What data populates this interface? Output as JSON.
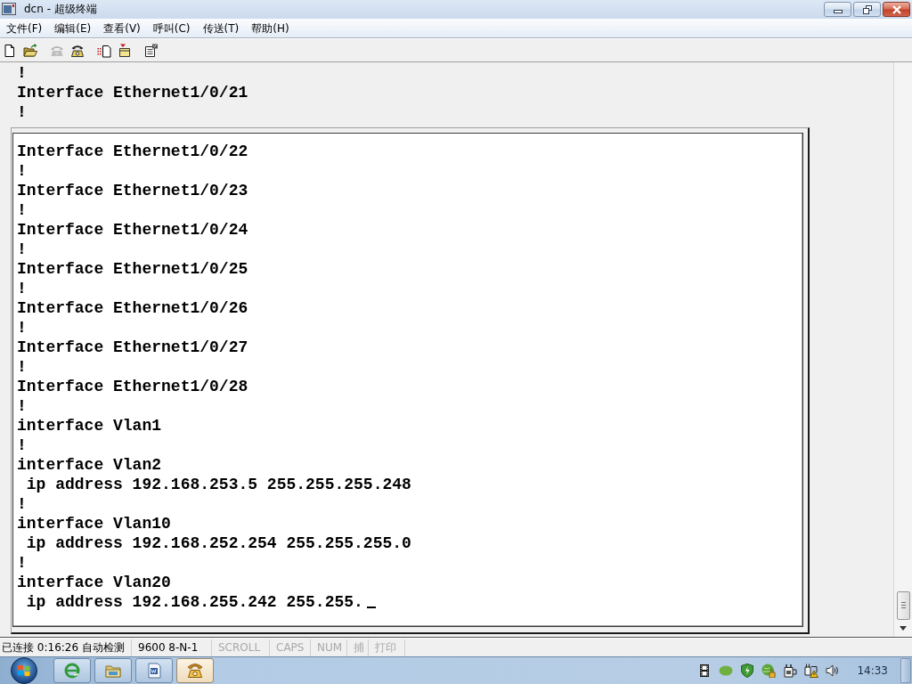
{
  "window": {
    "title": "dcn - 超级终端"
  },
  "menu_bar": [
    "文件(F)",
    "编辑(E)",
    "查看(V)",
    "呼叫(C)",
    "传送(T)",
    "帮助(H)"
  ],
  "toolbar": [
    {
      "disabled": false
    },
    {
      "disabled": false
    },
    {
      "disabled": true
    },
    {
      "disabled": false
    },
    {
      "disabled": false
    },
    {
      "disabled": false
    },
    {
      "disabled": false
    }
  ],
  "terminal": {
    "lines": [
      "!",
      "Interface Ethernet1/0/21",
      "!"
    ],
    "panel": {
      "lines": [
        "Interface Ethernet1/0/22",
        "!",
        "Interface Ethernet1/0/23",
        "!",
        "Interface Ethernet1/0/24",
        "!",
        "Interface Ethernet1/0/25",
        "!",
        "Interface Ethernet1/0/26",
        "!",
        "Interface Ethernet1/0/27",
        "!",
        "Interface Ethernet1/0/28",
        "!",
        "interface Vlan1",
        "!",
        "interface Vlan2",
        " ip address 192.168.253.5 255.255.255.248",
        "!",
        "interface Vlan10",
        " ip address 192.168.252.254 255.255.255.0",
        "!",
        "interface Vlan20",
        " ip address 192.168.255.242 255.255."
      ],
      "cursor": true
    }
  },
  "status_bar": [
    {
      "text": "已连接 0:16:26 自动检测",
      "enabled": true
    },
    {
      "text": "9600 8-N-1",
      "enabled": true
    },
    {
      "text": "SCROLL",
      "enabled": false
    },
    {
      "text": "CAPS",
      "enabled": false
    },
    {
      "text": "NUM",
      "enabled": false
    },
    {
      "text": "捕",
      "enabled": false
    },
    {
      "text": "打印",
      "enabled": false
    }
  ],
  "taskbar": {
    "apps": [
      {
        "selected": false
      },
      {
        "selected": false
      },
      {
        "selected": false
      },
      {
        "selected": true
      }
    ],
    "clock": "14:33"
  }
}
